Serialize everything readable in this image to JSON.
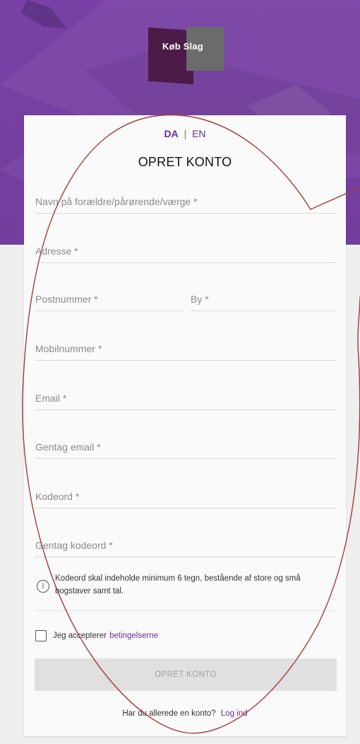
{
  "brand": {
    "logo_text": "Køb Slag",
    "colors": {
      "primary": "#6a2f95",
      "hero": "#6e32a0",
      "logo_dark": "#4c1b47",
      "logo_gray": "#6b6b6b"
    }
  },
  "language": {
    "active": "DA",
    "separator": "|",
    "other": "EN"
  },
  "form": {
    "title": "OPRET KONTO",
    "fields": {
      "guardian_name": {
        "placeholder": "Navn på forældre/pårørende/værge *",
        "value": ""
      },
      "address": {
        "placeholder": "Adresse *",
        "value": ""
      },
      "postcode": {
        "placeholder": "Postnummer *",
        "value": ""
      },
      "city": {
        "placeholder": "By *",
        "value": ""
      },
      "mobile": {
        "placeholder": "Mobilnummer *",
        "value": ""
      },
      "email": {
        "placeholder": "Email *",
        "value": ""
      },
      "email_repeat": {
        "placeholder": "Gentag email *",
        "value": ""
      },
      "password": {
        "placeholder": "Kodeord *",
        "value": ""
      },
      "password_repeat": {
        "placeholder": "Gentag kodeord *",
        "value": ""
      }
    },
    "info_icon": "info-circle-icon",
    "password_hint": "Kodeord skal indeholde minimum 6 tegn, bestående af store og små bogstaver samt tal.",
    "terms": {
      "prefix": "Jeg accepterer",
      "link": "betingelserne",
      "checked": false
    },
    "submit_label": "OPRET KONTO",
    "footer": {
      "text": "Har du allerede en konto?",
      "link": "Log ind"
    }
  },
  "annotation": {
    "color": "#a33b3b"
  }
}
